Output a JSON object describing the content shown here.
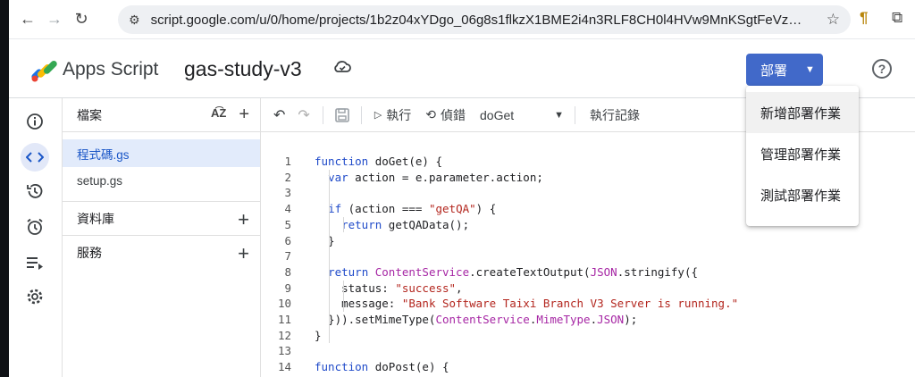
{
  "browser": {
    "url": "script.google.com/u/0/home/projects/1b2z04xYDgo_06g8s1flkzX1BME2i4n3RLF8CH0l4HVw9MnKSgtFeVzQL/e..."
  },
  "header": {
    "app_name": "Apps Script",
    "project_name": "gas-study-v3",
    "deploy_label": "部署",
    "help_label": "?"
  },
  "files": {
    "title": "檔案",
    "items": [
      {
        "label": "程式碼.gs",
        "active": true
      },
      {
        "label": "setup.gs",
        "active": false
      }
    ],
    "sections": [
      {
        "label": "資料庫"
      },
      {
        "label": "服務"
      }
    ]
  },
  "toolbar": {
    "run_label": "執行",
    "debug_label": "偵錯",
    "function_select": "doGet",
    "log_label": "執行記錄"
  },
  "deploy_menu": {
    "items": [
      "新增部署作業",
      "管理部署作業",
      "測試部署作業"
    ]
  },
  "code_lines": [
    {
      "n": "1",
      "text": "function doGet(e) {"
    },
    {
      "n": "2",
      "text": "  var action = e.parameter.action;"
    },
    {
      "n": "3",
      "text": ""
    },
    {
      "n": "4",
      "text": "  if (action === \"getQA\") {"
    },
    {
      "n": "5",
      "text": "    return getQAData();"
    },
    {
      "n": "6",
      "text": "  }"
    },
    {
      "n": "7",
      "text": ""
    },
    {
      "n": "8",
      "text": "  return ContentService.createTextOutput(JSON.stringify({"
    },
    {
      "n": "9",
      "text": "    status: \"success\","
    },
    {
      "n": "10",
      "text": "    message: \"Bank Software Taixi Branch V3 Server is running.\""
    },
    {
      "n": "11",
      "text": "  })).setMimeType(ContentService.MimeType.JSON);"
    },
    {
      "n": "12",
      "text": "}"
    },
    {
      "n": "13",
      "text": ""
    },
    {
      "n": "14",
      "text": "function doPost(e) {"
    }
  ]
}
